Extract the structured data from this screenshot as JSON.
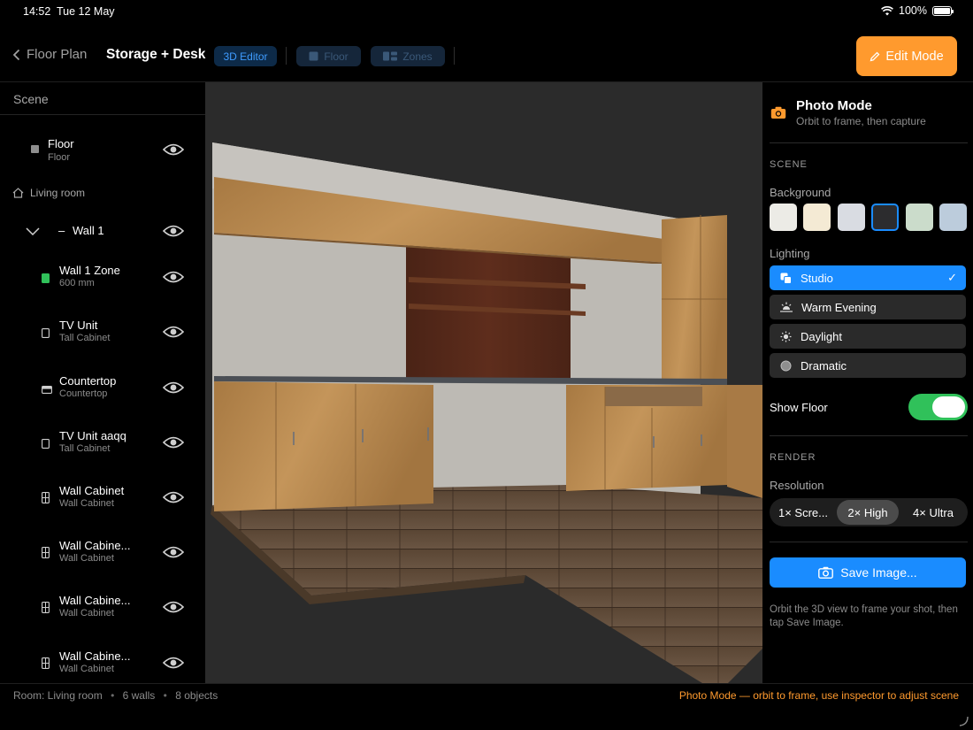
{
  "status": {
    "time": "14:52",
    "date": "Tue 12 May",
    "battery": "100%"
  },
  "toolbar": {
    "back_label": "Floor Plan",
    "title": "Storage + Desk",
    "editor_chip": "3D Editor",
    "floor_chip": "Floor",
    "zones_chip": "Zones",
    "edit_mode": "Edit Mode"
  },
  "sidebar": {
    "header": "Scene",
    "floor": {
      "title": "Floor",
      "subtitle": "Floor"
    },
    "room": "Living room",
    "wall": "Wall 1",
    "items": [
      {
        "title": "Wall 1 Zone",
        "subtitle": "600 mm",
        "icon": "zone-icon"
      },
      {
        "title": "TV Unit",
        "subtitle": "Tall Cabinet",
        "icon": "tall-cabinet-icon"
      },
      {
        "title": "Countertop",
        "subtitle": "Countertop",
        "icon": "countertop-icon"
      },
      {
        "title": "TV Unit aaqq",
        "subtitle": "Tall Cabinet",
        "icon": "tall-cabinet-icon"
      },
      {
        "title": "Wall Cabinet",
        "subtitle": "Wall Cabinet",
        "icon": "wall-cabinet-icon"
      },
      {
        "title": "Wall Cabine...",
        "subtitle": "Wall Cabinet",
        "icon": "wall-cabinet-icon"
      },
      {
        "title": "Wall Cabine...",
        "subtitle": "Wall Cabinet",
        "icon": "wall-cabinet-icon"
      },
      {
        "title": "Wall Cabine...",
        "subtitle": "Wall Cabinet",
        "icon": "wall-cabinet-icon"
      }
    ]
  },
  "inspector": {
    "title": "Photo Mode",
    "subtitle": "Orbit to frame, then capture",
    "scene_section": "SCENE",
    "background_label": "Background",
    "backgrounds": [
      "#ecebe6",
      "#f4ead4",
      "#d9dce2",
      "#2c2c2e",
      "#cbdccb",
      "#bcccdc"
    ],
    "selected_background": 3,
    "lighting_label": "Lighting",
    "lighting": [
      {
        "label": "Studio",
        "icon": "studio-icon",
        "selected": true
      },
      {
        "label": "Warm Evening",
        "icon": "sunset-icon",
        "selected": false
      },
      {
        "label": "Daylight",
        "icon": "sun-icon",
        "selected": false
      },
      {
        "label": "Dramatic",
        "icon": "circle-icon",
        "selected": false
      }
    ],
    "show_floor_label": "Show Floor",
    "show_floor": true,
    "render_section": "RENDER",
    "resolution_label": "Resolution",
    "resolutions": [
      "1× Scre...",
      "2× High",
      "4× Ultra"
    ],
    "selected_resolution": 1,
    "save_label": "Save Image...",
    "help": "Orbit the 3D view to frame your shot, then tap Save Image."
  },
  "footer": {
    "room": "Room: Living room",
    "walls": "6 walls",
    "objects": "8 objects",
    "mode_hint": "Photo Mode — orbit to frame, use inspector to adjust scene"
  },
  "colors": {
    "accent": "#1a8cff",
    "orange": "#ff9a2e",
    "toggle_on": "#30c15a"
  }
}
